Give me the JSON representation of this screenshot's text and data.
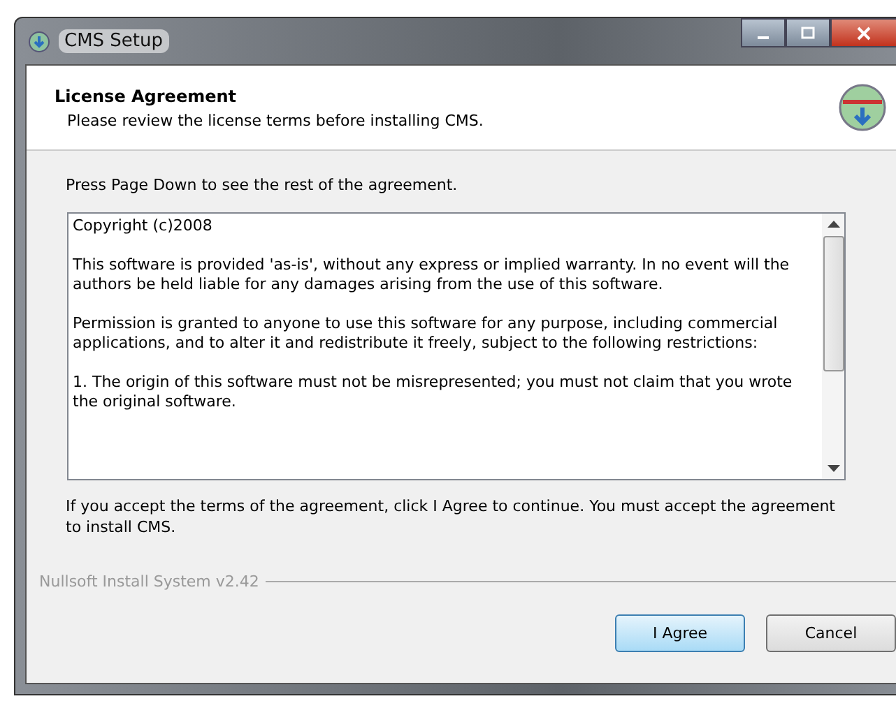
{
  "window": {
    "title": "CMS Setup"
  },
  "header": {
    "title": "License Agreement",
    "subtitle": "Please review the license terms before installing CMS."
  },
  "instruction": "Press Page Down to see the rest of the agreement.",
  "license_text": [
    "Copyright (c)2008",
    "This software is provided 'as-is', without any express or implied warranty. In no event will the authors be held liable for any damages arising from the use of this software.",
    "Permission is granted to anyone to use this software for any purpose, including commercial applications, and to alter it and redistribute it freely, subject to the following restrictions:",
    "1. The origin of this software must not be misrepresented; you must not claim that you wrote the original software."
  ],
  "notice": "If you accept the terms of the agreement, click I Agree to continue. You must accept the agreement to install CMS.",
  "branding": "Nullsoft Install System v2.42",
  "buttons": [
    {
      "label": "I Agree",
      "focused": true
    },
    {
      "label": "Cancel",
      "focused": false
    }
  ]
}
